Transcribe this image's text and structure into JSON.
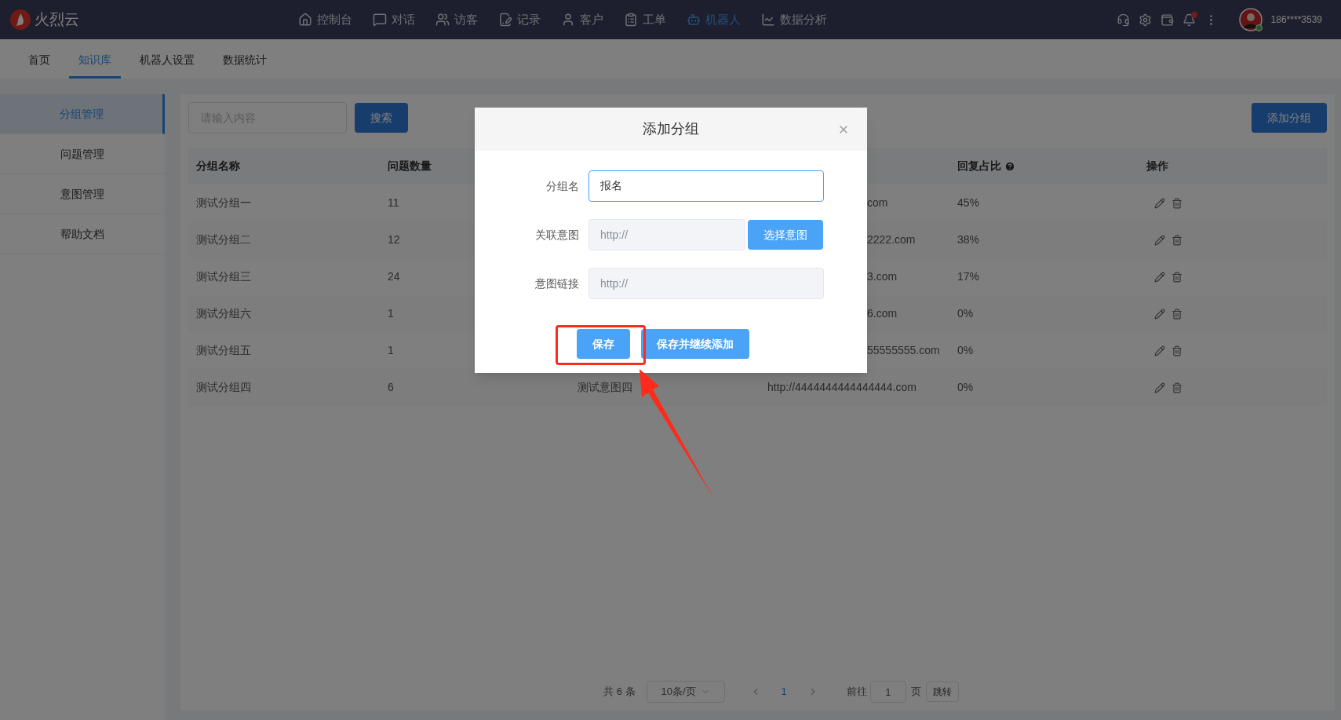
{
  "top_bar": {
    "logo": "火烈云",
    "nav": [
      {
        "label": "控制台",
        "selected": false
      },
      {
        "label": "对话",
        "selected": false
      },
      {
        "label": "访客",
        "selected": false
      },
      {
        "label": "记录",
        "selected": false
      },
      {
        "label": "客户",
        "selected": false
      },
      {
        "label": "工单",
        "selected": false
      },
      {
        "label": "机器人",
        "selected": true
      },
      {
        "label": "数据分析",
        "selected": false
      }
    ],
    "notifications_unread": true,
    "user": "186****3539",
    "online": true
  },
  "sub_tabs": [
    {
      "label": "首页",
      "selected": false
    },
    {
      "label": "知识库",
      "selected": true
    },
    {
      "label": "机器人设置",
      "selected": false
    },
    {
      "label": "数据统计",
      "selected": false
    }
  ],
  "sidebar": {
    "items": [
      {
        "label": "分组管理",
        "selected": true
      },
      {
        "label": "问题管理",
        "selected": false
      },
      {
        "label": "意图管理",
        "selected": false
      },
      {
        "label": "帮助文档",
        "selected": false
      }
    ]
  },
  "toolbar": {
    "search_placeholder": "请输入内容",
    "search_button": "搜索",
    "add_button": "添加分组"
  },
  "table": {
    "columns": [
      {
        "label": "分组名称"
      },
      {
        "label": "问题数量"
      },
      {},
      {},
      {
        "label": "回复占比",
        "help": true
      },
      {
        "label": "操作"
      }
    ],
    "rows": [
      {
        "name": "测试分组一",
        "count": "11",
        "column_4": "com",
        "covered": true,
        "ratio": "45%"
      },
      {
        "name": "测试分组二",
        "count": "12",
        "column_4": "2222.com",
        "covered": true,
        "ratio": "38%"
      },
      {
        "name": "测试分组三",
        "count": "24",
        "column_4": "3.com",
        "covered": true,
        "ratio": "17%"
      },
      {
        "name": "测试分组六",
        "count": "1",
        "column_4": "6.com",
        "covered": true,
        "ratio": "0%"
      },
      {
        "name": "测试分组五",
        "count": "1",
        "column_4": "55555555.com",
        "covered": true,
        "ratio": "0%"
      },
      {
        "name": "测试分组四",
        "count": "6",
        "column_3": "测试意图四",
        "column_4": "http://4444444444444444.com",
        "covered": false,
        "ratio": "0%"
      }
    ]
  },
  "pagination": {
    "total": "共 6 条",
    "page_size": "10条/页",
    "pages": [
      {
        "label": "1",
        "selected": true
      }
    ],
    "goto_label": "前往",
    "goto_value": "1",
    "page_unit": "页",
    "jump_button": "跳转"
  },
  "dialog": {
    "title": "添加分组",
    "fields": [
      {
        "label": "分组名",
        "kind": "text",
        "value": "报名",
        "focused": true,
        "disabled": false
      },
      {
        "label": "关联意图",
        "kind": "picker",
        "placeholder": "http://",
        "button": "选择意图",
        "focused": false,
        "disabled": true
      },
      {
        "label": "意图链接",
        "kind": "text",
        "placeholder": "http://",
        "focused": false,
        "disabled": true
      }
    ],
    "buttons": [
      "保存",
      "保存并继续添加"
    ]
  }
}
